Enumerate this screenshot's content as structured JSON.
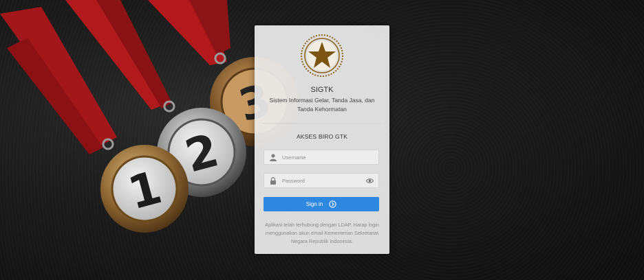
{
  "brand": {
    "app_name": "SIGTK",
    "app_full_name": "Sistem Informasi Gelar, Tanda Jasa, dan Tanda Kehormatan",
    "emblem_icon": "star-emblem-icon",
    "emblem_color": "#7a5410"
  },
  "login": {
    "section_title": "AKSES BIRO GTK",
    "username": {
      "placeholder": "Username",
      "value": "",
      "icon": "user-icon"
    },
    "password": {
      "placeholder": "Password",
      "value": "",
      "icon": "lock-icon",
      "toggle_icon": "eye-icon"
    },
    "signin_label": "Sign in",
    "signin_icon": "arrow-circle-right-icon",
    "signin_color": "#2f88df",
    "note": "Aplikasi telah terhubung dengan LDAP. Harap login menggunakan akun email Kementerian Sekretariat Negara Republik Indonesia."
  },
  "background": {
    "medals": [
      "1",
      "2",
      "3"
    ],
    "ribbon_color": "#b3191c"
  }
}
